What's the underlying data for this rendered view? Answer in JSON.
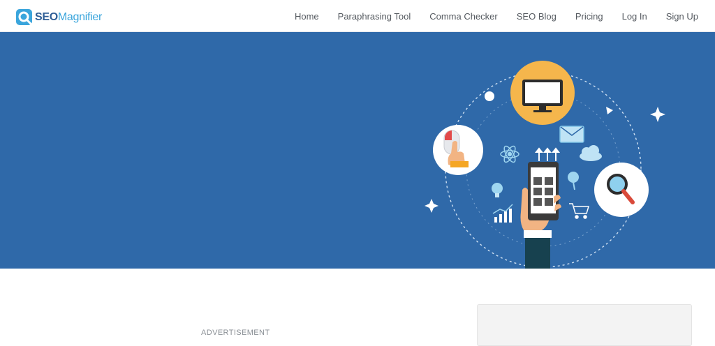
{
  "brand": {
    "seo": "SEO",
    "magnifier": "Magnifier"
  },
  "nav": {
    "items": [
      {
        "label": "Home"
      },
      {
        "label": "Paraphrasing Tool"
      },
      {
        "label": "Comma Checker"
      },
      {
        "label": "SEO Blog"
      },
      {
        "label": "Pricing"
      },
      {
        "label": "Log In"
      },
      {
        "label": "Sign Up"
      }
    ]
  },
  "content": {
    "ad_label": "ADVERTISEMENT"
  },
  "colors": {
    "hero_bg": "#2f69a9",
    "brand_dark": "#2f5e96",
    "brand_light": "#3aa5dc",
    "nav_text": "#555a60"
  }
}
